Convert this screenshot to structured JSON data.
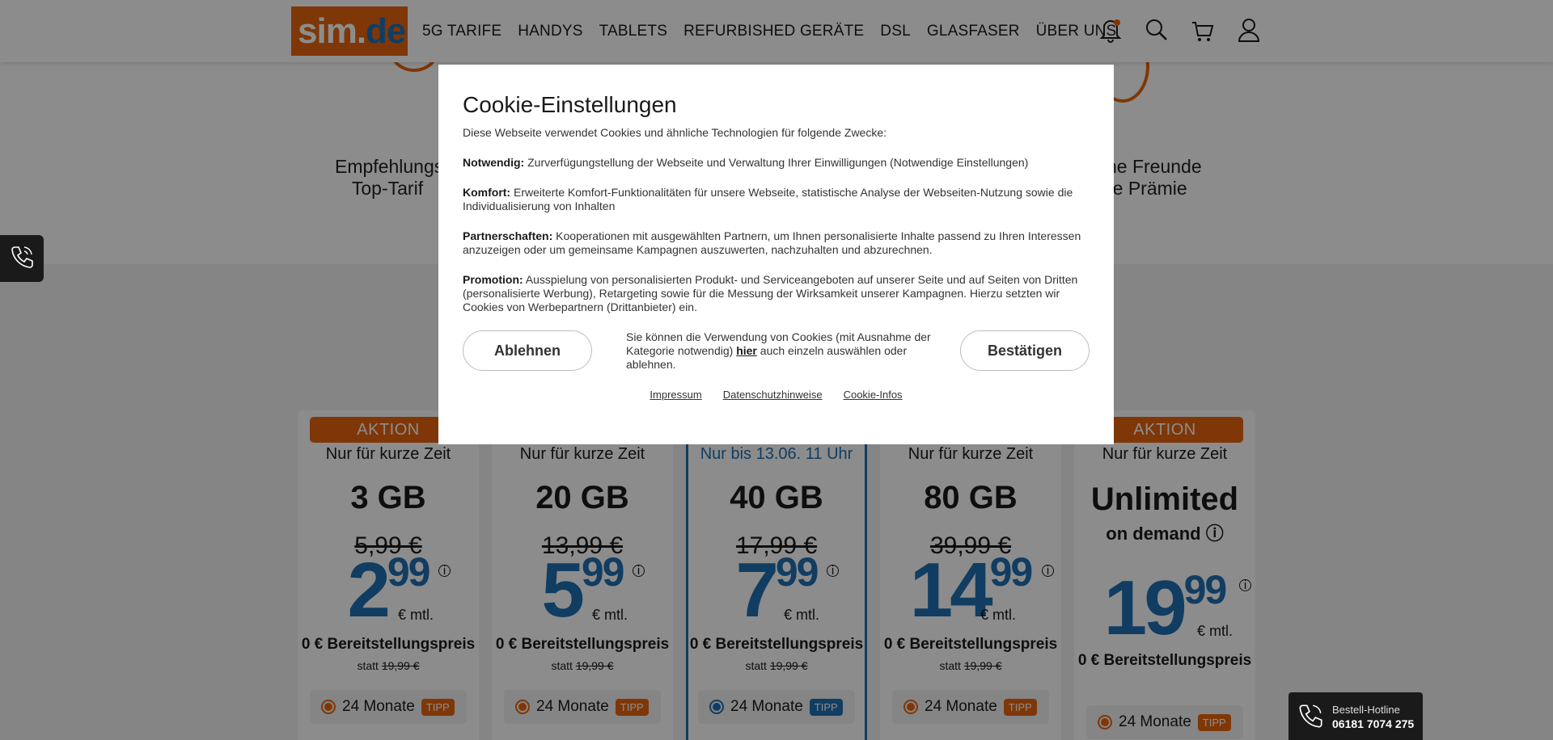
{
  "header": {
    "logo": {
      "part1": "sim.",
      "part2": "de"
    },
    "nav": [
      "5G TARIFE",
      "HANDYS",
      "TABLETS",
      "REFURBISHED GERÄTE",
      "DSL",
      "GLASFASER",
      "ÜBER UNS"
    ],
    "icons": [
      "bell-icon",
      "search-icon",
      "cart-icon",
      "user-icon"
    ]
  },
  "benefits": {
    "left_line1": "Empfehlungs",
    "left_line2": "Top-Tarif",
    "right_line1": "ne Freunde",
    "right_line2": "re Prämie"
  },
  "cookie": {
    "title": "Cookie-Einstellungen",
    "intro": "Diese Webseite verwendet Cookies und ähnliche Technologien für folgende Zwecke:",
    "sections": [
      {
        "label": "Notwendig:",
        "text": " Zurverfügungstellung der Webseite und Verwaltung Ihrer Einwilligungen (Notwendige Einstellungen)"
      },
      {
        "label": "Komfort:",
        "text": " Erweiterte Komfort-Funktionalitäten für unsere Webseite, statistische Analyse der Webseiten-Nutzung sowie die Individualisierung von Inhalten"
      },
      {
        "label": "Partnerschaften:",
        "text": " Kooperationen mit ausgewählten Partnern, um Ihnen personalisierte Inhalte passend zu Ihren Interessen anzuzeigen oder um gemeinsame Kampagnen auszuwerten, nachzuhalten und abzurechnen."
      },
      {
        "label": "Promotion:",
        "text": " Ausspielung von personalisierten Produkt- und Serviceangeboten auf unserer Seite und auf Seiten von Dritten (personalisierte Werbung), Retargeting sowie für die Messung der Wirksamkeit unserer Kampagnen. Hierzu setzten wir Cookies von Werbepartnern (Drittanbieter) ein."
      }
    ],
    "decline_label": "Ablehnen",
    "accept_label": "Bestätigen",
    "choice_text_before": "Sie können die Verwendung von Cookies (mit Ausnahme der Kategorie notwendig) ",
    "choice_link": "hier",
    "choice_text_after": " auch einzeln auswählen oder ablehnen.",
    "links": [
      "Impressum",
      "Datenschutzhinweise",
      "Cookie-Infos"
    ]
  },
  "tariffs": [
    {
      "badge": "AKTION",
      "subtitle": "Nur für kurze Zeit",
      "volume": "3 GB",
      "extra": "",
      "old_price": "5,99 €",
      "price_euro": "2",
      "price_cents": "99",
      "unit": "€ mtl.",
      "setup": "0 € Bereitstellungspreis",
      "statt": "statt",
      "statt_price": "19,99 €",
      "term": "24 Monate",
      "tag": "TIPP",
      "highlight": false
    },
    {
      "badge": "",
      "subtitle": "Nur für kurze Zeit",
      "volume": "20 GB",
      "extra": "",
      "old_price": "13,99 €",
      "price_euro": "5",
      "price_cents": "99",
      "unit": "€ mtl.",
      "setup": "0 € Bereitstellungspreis",
      "statt": "statt",
      "statt_price": "19,99 €",
      "term": "24 Monate",
      "tag": "TIPP",
      "highlight": false
    },
    {
      "badge": "",
      "subtitle": "Nur bis 13.06. 11 Uhr",
      "volume": "40 GB",
      "extra": "",
      "old_price": "17,99 €",
      "price_euro": "7",
      "price_cents": "99",
      "unit": "€ mtl.",
      "setup": "0 € Bereitstellungspreis",
      "statt": "statt",
      "statt_price": "19,99 €",
      "term": "24 Monate",
      "tag": "TIPP",
      "highlight": true
    },
    {
      "badge": "",
      "subtitle": "Nur für kurze Zeit",
      "volume": "80 GB",
      "extra": "",
      "old_price": "39,99 €",
      "price_euro": "14",
      "price_cents": "99",
      "unit": "€ mtl.",
      "setup": "0 € Bereitstellungspreis",
      "statt": "statt",
      "statt_price": "19,99 €",
      "term": "24 Monate",
      "tag": "TIPP",
      "highlight": false
    },
    {
      "badge": "AKTION",
      "subtitle": "Nur für kurze Zeit",
      "volume": "Unlimited",
      "extra": "on demand ⓘ",
      "old_price": "",
      "price_euro": "19",
      "price_cents": "99",
      "unit": "€ mtl.",
      "setup": "0 € Bereitstellungspreis",
      "statt": "",
      "statt_price": "",
      "term": "24 Monate",
      "tag": "TIPP",
      "highlight": false
    }
  ],
  "hotline": {
    "label": "Bestell-Hotline",
    "number": "06181 7074 275"
  },
  "colors": {
    "brand_orange": "#e8650e",
    "brand_blue": "#1f6fb2"
  }
}
